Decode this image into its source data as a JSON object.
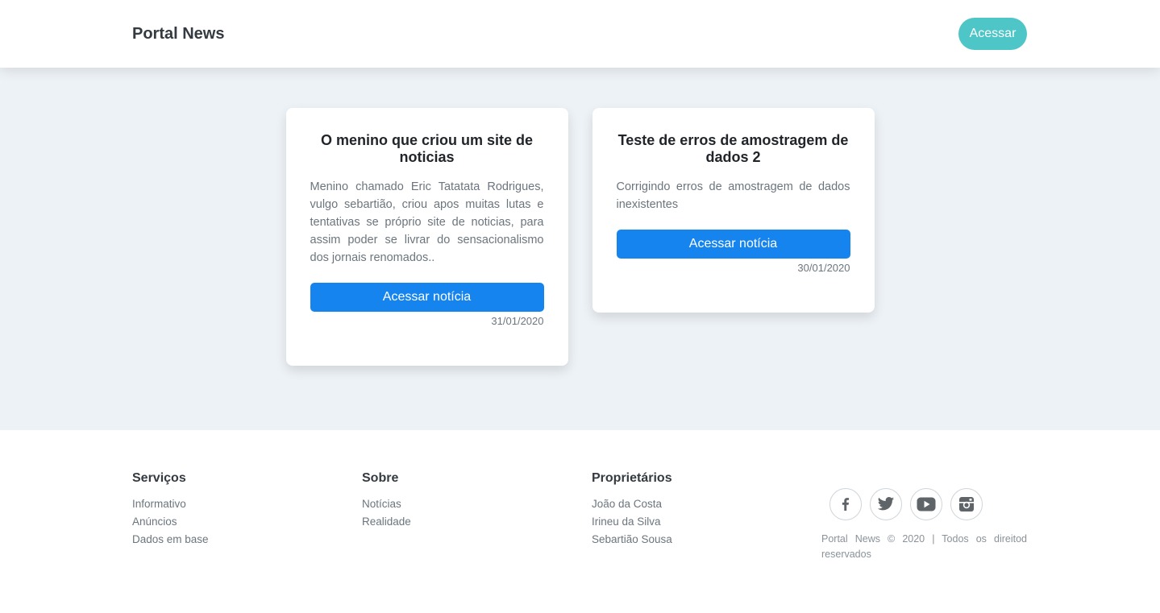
{
  "navbar": {
    "brand": "Portal News",
    "login_label": "Acessar"
  },
  "cards": [
    {
      "title": "O menino que criou um site de noticias",
      "text": "Menino chamado Eric Tatatata Rodrigues, vulgo sebartião, criou apos muitas lutas e tentativas se próprio site de noticias, para assim poder se livrar do sensacionalismo dos jornais renomados..",
      "button_label": "Acessar notícia",
      "date": "31/01/2020"
    },
    {
      "title": "Teste de erros de amostragem de dados 2",
      "text": "Corrigindo erros de amostragem de dados inexistentes",
      "button_label": "Acessar notícia",
      "date": "30/01/2020"
    }
  ],
  "footer": {
    "servicos": {
      "title": "Serviços",
      "links": [
        "Informativo",
        "Anúncios",
        "Dados em base"
      ]
    },
    "sobre": {
      "title": "Sobre",
      "links": [
        "Notícias",
        "Realidade"
      ]
    },
    "proprietarios": {
      "title": "Proprietários",
      "links": [
        "João da Costa",
        "Irineu da Silva",
        "Sebartião Sousa"
      ]
    },
    "social_icons": [
      "facebook-icon",
      "twitter-icon",
      "youtube-icon",
      "instagram-icon"
    ],
    "copyright": "Portal News © 2020 | Todos os direitod reservados"
  },
  "colors": {
    "login_button": "#4ec5c6",
    "news_button": "#1584ee",
    "main_background": "#edf2f6"
  }
}
